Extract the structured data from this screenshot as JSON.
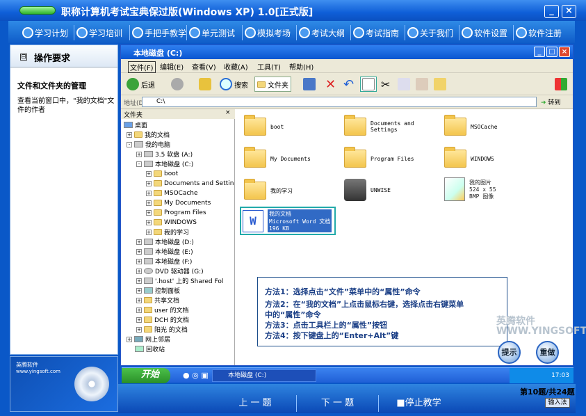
{
  "app_title": "职称计算机考试宝典保过版(Windows XP) 1.0[正式版]",
  "window_controls": {
    "minimize": "_",
    "close": "×"
  },
  "nav": [
    "学习计划",
    "学习培训",
    "手把手教学",
    "单元测试",
    "模拟考场",
    "考试大纲",
    "考试指南",
    "关于我们",
    "软件设置",
    "软件注册"
  ],
  "left": {
    "header": "操作要求",
    "task_title": "文件和文件夹的管理",
    "task_desc": "查看当前窗口中，\"我的文档\"文件的作者",
    "logo_line1": "英腾软件",
    "logo_line2": "www.yingsoft.com",
    "logo_cd": "CD Enhanced"
  },
  "xp": {
    "title": "本地磁盘 (C:)",
    "menu": [
      "文件(F)",
      "编辑(E)",
      "查看(V)",
      "收藏(A)",
      "工具(T)",
      "帮助(H)"
    ],
    "toolbar": {
      "back": "后退",
      "search": "搜索",
      "folders": "文件夹"
    },
    "address_label": "地址(D)",
    "address_value": "C:\\",
    "go": "转到",
    "folders_header": "文件夹",
    "tree": [
      "桌面",
      "我的文档",
      "我的电脑",
      "3.5 软盘 (A:)",
      "本地磁盘 (C:)",
      "boot",
      "Documents and Settin",
      "MSOCache",
      "My Documents",
      "Program Files",
      "WINDOWS",
      "我的学习",
      "本地磁盘 (D:)",
      "本地磁盘 (E:)",
      "本地磁盘 (F:)",
      "DVD 驱动器 (G:)",
      "'.host' 上的 Shared Fol",
      "控制面板",
      "共享文档",
      "user 的文档",
      "DCH 的文档",
      "阳光 的文档",
      "网上邻居",
      "回收站"
    ],
    "items": [
      "boot",
      "Documents and\nSettings",
      "MSOCache",
      "My Documents",
      "Program Files",
      "WINDOWS",
      "我的学习",
      "UNWISE",
      "我的图片\n524 x 55\nBMP 图像",
      "我的文档\nMicrosoft Word 文档\n196 KB"
    ],
    "taskbar_start": "开始",
    "taskbar_window": "本地磁盘 (C:)",
    "clock": "17:03"
  },
  "hints": [
    "方法1：选择点击“文件”菜单中的“属性”命令",
    "方法2：在“我的文档”上点击鼠标右键，选择点击右键菜单",
    "中的“属性”命令",
    "方法3：点击工具栏上的“属性”按钮",
    "方法4：按下键盘上的“Enter+Alt”键"
  ],
  "watermark": "英腾软件\nWWW.YINGSOFT.COM",
  "hint_button": "提示",
  "redo_button": "重做",
  "bottom": {
    "prev": "上 一 题",
    "next": "下 一 题",
    "stop": "■停止教学",
    "page": "第10题/共24题",
    "ime": "输入法"
  }
}
